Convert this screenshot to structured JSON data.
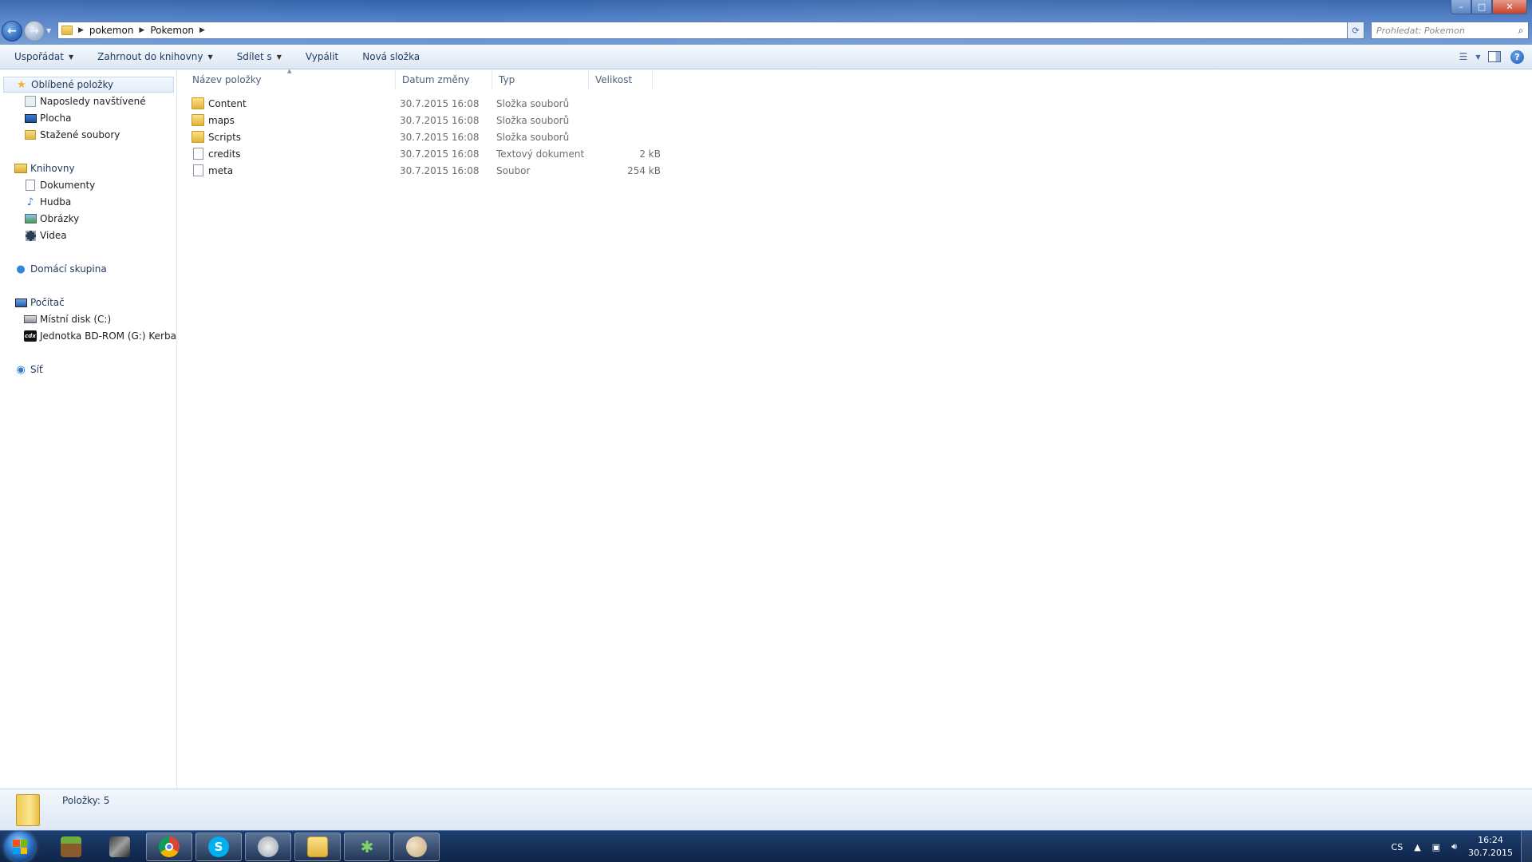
{
  "window": {
    "controls": {
      "minimize": "–",
      "maximize": "□",
      "close": "✕"
    }
  },
  "address": {
    "crumbs": [
      "pokemon",
      "Pokemon"
    ],
    "search_placeholder": "Prohledat: Pokemon"
  },
  "toolbar": {
    "organize": "Uspořádat",
    "include_library": "Zahrnout do knihovny",
    "share": "Sdílet s",
    "burn": "Vypálit",
    "new_folder": "Nová složka"
  },
  "navpane": {
    "favorites": {
      "label": "Oblíbené položky",
      "items": [
        "Naposledy navštívené",
        "Plocha",
        "Stažené soubory"
      ]
    },
    "libraries": {
      "label": "Knihovny",
      "items": [
        "Dokumenty",
        "Hudba",
        "Obrázky",
        "Videa"
      ]
    },
    "homegroup": {
      "label": "Domácí skupina"
    },
    "computer": {
      "label": "Počítač",
      "items": [
        "Místní disk (C:)",
        "Jednotka BD-ROM (G:) Kerbal Sp"
      ]
    },
    "network": {
      "label": "Síť"
    }
  },
  "list": {
    "columns": {
      "name": "Název položky",
      "date": "Datum změny",
      "type": "Typ",
      "size": "Velikost"
    },
    "rows": [
      {
        "name": "Content",
        "date": "30.7.2015 16:08",
        "type": "Složka souborů",
        "size": ""
      },
      {
        "name": "maps",
        "date": "30.7.2015 16:08",
        "type": "Složka souborů",
        "size": ""
      },
      {
        "name": "Scripts",
        "date": "30.7.2015 16:08",
        "type": "Složka souborů",
        "size": ""
      },
      {
        "name": "credits",
        "date": "30.7.2015 16:08",
        "type": "Textový dokument",
        "size": "2 kB"
      },
      {
        "name": "meta",
        "date": "30.7.2015 16:08",
        "type": "Soubor",
        "size": "254 kB"
      }
    ]
  },
  "details": {
    "count": "Položky: 5"
  },
  "taskbar": {
    "language": "CS",
    "time": "16:24",
    "date": "30.7.2015",
    "apps": [
      "minecraft-icon",
      "game-icon",
      "chrome-icon",
      "skype-icon",
      "media-player-icon",
      "explorer-icon",
      "tool-icon",
      "paint-icon"
    ]
  },
  "colors": {
    "titlebar": "#4a7bc4",
    "taskbar": "#15305a",
    "folder": "#e3b43a",
    "header_text": "#4c607a"
  }
}
